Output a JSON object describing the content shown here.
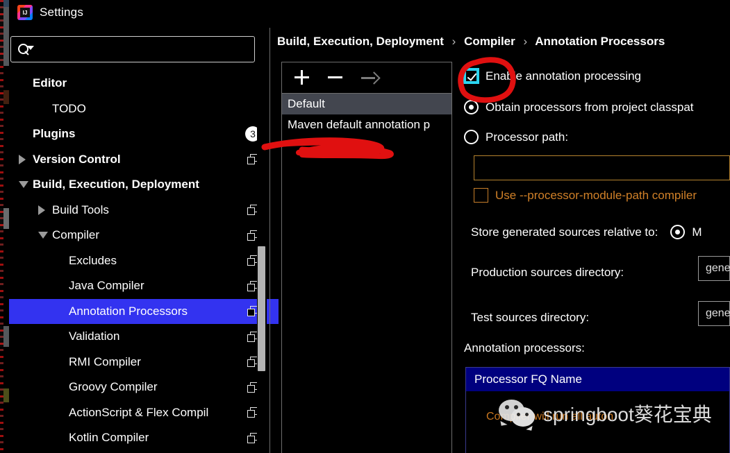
{
  "window": {
    "title": "Settings",
    "app_icon": "intellij-idea-logo"
  },
  "search": {
    "value": "",
    "placeholder": "",
    "icon": "search-icon"
  },
  "sidebar": {
    "items": [
      {
        "label": "Editor",
        "indent": 34,
        "bold": true,
        "twisty": "none",
        "trailing": "none"
      },
      {
        "label": "TODO",
        "indent": 62,
        "bold": false,
        "twisty": "none",
        "trailing": "none"
      },
      {
        "label": "Plugins",
        "indent": 34,
        "bold": true,
        "twisty": "none",
        "trailing": "badge",
        "badge": "3"
      },
      {
        "label": "Version Control",
        "indent": 34,
        "bold": true,
        "twisty": "right",
        "trailing": "copy"
      },
      {
        "label": "Build, Execution, Deployment",
        "indent": 34,
        "bold": true,
        "twisty": "down",
        "trailing": "none"
      },
      {
        "label": "Build Tools",
        "indent": 62,
        "bold": false,
        "twisty": "right",
        "trailing": "copy"
      },
      {
        "label": "Compiler",
        "indent": 62,
        "bold": false,
        "twisty": "down",
        "trailing": "copy"
      },
      {
        "label": "Excludes",
        "indent": 86,
        "bold": false,
        "twisty": "none",
        "trailing": "copy"
      },
      {
        "label": "Java Compiler",
        "indent": 86,
        "bold": false,
        "twisty": "none",
        "trailing": "copy"
      },
      {
        "label": "Annotation Processors",
        "indent": 86,
        "bold": false,
        "twisty": "none",
        "trailing": "copy",
        "selected": true
      },
      {
        "label": "Validation",
        "indent": 86,
        "bold": false,
        "twisty": "none",
        "trailing": "copy"
      },
      {
        "label": "RMI Compiler",
        "indent": 86,
        "bold": false,
        "twisty": "none",
        "trailing": "copy"
      },
      {
        "label": "Groovy Compiler",
        "indent": 86,
        "bold": false,
        "twisty": "none",
        "trailing": "copy"
      },
      {
        "label": "ActionScript & Flex Compil",
        "indent": 86,
        "bold": false,
        "twisty": "none",
        "trailing": "copy"
      },
      {
        "label": "Kotlin Compiler",
        "indent": 86,
        "bold": false,
        "twisty": "none",
        "trailing": "copy"
      }
    ],
    "selected_color": "#3333f0",
    "scrollbar_color": "#b3b3b3"
  },
  "breadcrumb": {
    "part1": "Build, Execution, Deployment",
    "sep1": "›",
    "part2": "Compiler",
    "sep2": "›",
    "part3": "Annotation Processors"
  },
  "profile_panel": {
    "toolbar": {
      "add_icon": "plus-icon",
      "remove_icon": "minus-icon",
      "move_icon": "arrow-right-icon"
    },
    "items": [
      {
        "label": "Default",
        "selected": true
      },
      {
        "label": "Maven default annotation p",
        "selected": false
      },
      {
        "label": "",
        "selected": false,
        "obscured": true
      }
    ],
    "selected_color": "#43464f"
  },
  "options": {
    "enable_annotation_processing": {
      "label": "Enable annotation processing",
      "checked": true,
      "focused": true,
      "focus_color": "#2ad4f0"
    },
    "source_mode": {
      "obtain_from_classpath": {
        "label": "Obtain processors from project classpat",
        "selected": true
      },
      "processor_path": {
        "label": "Processor path:",
        "selected": false
      }
    },
    "processor_path_field": {
      "value": "",
      "enabled": false
    },
    "use_processor_module_path": {
      "label": "Use --processor-module-path compiler",
      "checked": false,
      "enabled": false,
      "disabled_color": "#d08028"
    },
    "store_generated_sources": {
      "label": "Store generated sources relative to:",
      "option_label": "M",
      "selected": true
    },
    "production_sources_directory": {
      "label": "Production sources directory:",
      "value": "gene"
    },
    "test_sources_directory": {
      "label": "Test sources directory:",
      "value": "gene"
    },
    "annotation_processors": {
      "label": "Annotation processors:",
      "column_header": "Processor FQ Name",
      "header_color": "#00007f",
      "rows": []
    },
    "hint": "Compiler will run all auton"
  },
  "annotations": {
    "circle_color": "#e01010",
    "circle_target": "enable-annotation-processing-checkbox",
    "scribble_color": "#e01010",
    "scribble_target": "profile-list-third-item"
  },
  "watermark": {
    "icon": "wechat-icon",
    "text": "springboot葵花宝典"
  }
}
